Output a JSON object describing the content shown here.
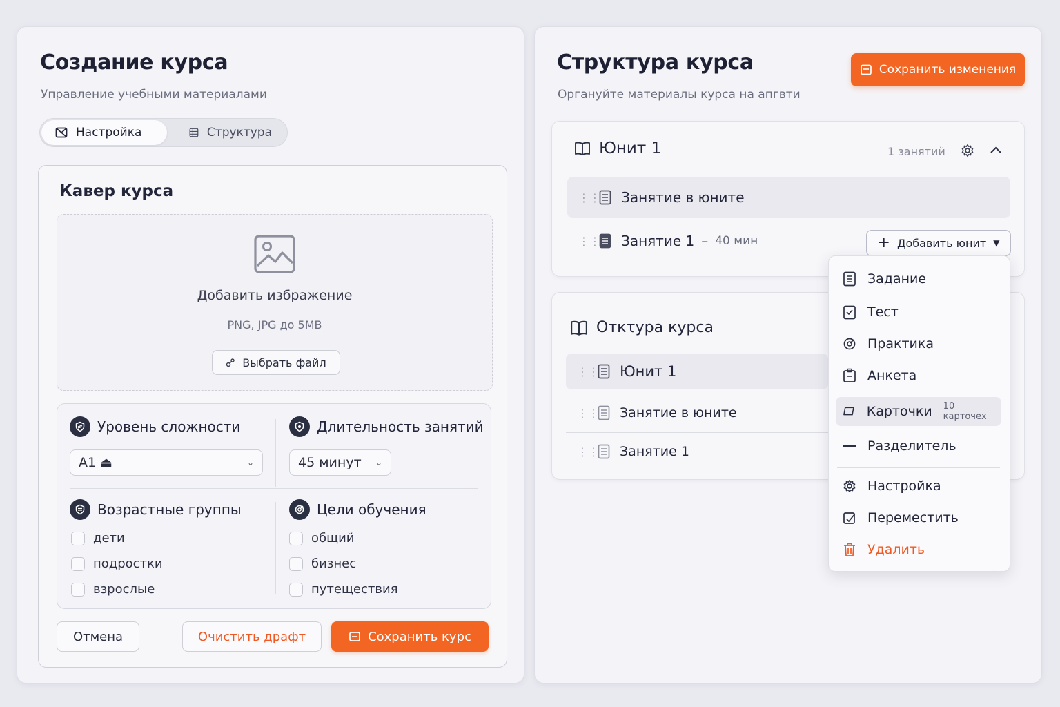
{
  "left": {
    "title": "Создание курса",
    "subtitle": "Управление учебными материалами",
    "tabs": [
      {
        "label": "Настройка",
        "icon": "settings-box-icon",
        "active": true
      },
      {
        "label": "Структура",
        "icon": "grid-icon",
        "active": false
      }
    ],
    "cover": {
      "title": "Кавер курса",
      "add_image": "Добавить избражение",
      "formats": "PNG, JPG до 5MB",
      "choose_file": "Выбрать файл"
    },
    "difficulty": {
      "title": "Уровень сложности",
      "value": "A1 ⏏"
    },
    "duration": {
      "title": "Длительность занятий",
      "value": "45 минут"
    },
    "ages": {
      "title": "Возрастные группы",
      "options": [
        "дети",
        "подростки",
        "взрослые"
      ]
    },
    "goals": {
      "title": "Цели обучения",
      "options": [
        "общий",
        "бизнес",
        "путеществия"
      ]
    },
    "actions": {
      "cancel": "Отмена",
      "clear": "Очистить драфт",
      "save": "Сохранить курс"
    }
  },
  "right": {
    "title": "Структура курса",
    "subtitle": "Органуйте материалы курса на апгвти",
    "save_changes": "Сохранить изменения",
    "unit": {
      "title": "Юнит 1",
      "count": "1 занятий",
      "rows": [
        {
          "label": "Занятие в юните",
          "meta": ""
        },
        {
          "label": "Занятие 1",
          "dash": "–",
          "meta": "40 мин"
        }
      ],
      "add_button": "Добавить юнит"
    },
    "structure": {
      "title": "Откτура курса",
      "rows": [
        "Юнит 1",
        "Занятие в юните",
        "Занятие 1"
      ]
    },
    "menu": {
      "items": [
        {
          "label": "Задание",
          "icon": "document-icon"
        },
        {
          "label": "Тест",
          "icon": "test-icon"
        },
        {
          "label": "Практика",
          "icon": "target-icon"
        },
        {
          "label": "Анкета",
          "icon": "survey-icon"
        },
        {
          "label": "Карточки",
          "icon": "cards-icon",
          "note": "10 карточех"
        },
        {
          "label": "Разделитель",
          "icon": "divider-icon"
        },
        {
          "label": "Настройка",
          "icon": "gear-icon"
        },
        {
          "label": "Переместить",
          "icon": "move-icon"
        },
        {
          "label": "Удалить",
          "icon": "trash-icon"
        }
      ]
    }
  },
  "colors": {
    "accent": "#f26522",
    "text": "#1f2233",
    "muted": "#6a6d7e",
    "bg": "#e9e9f0"
  }
}
